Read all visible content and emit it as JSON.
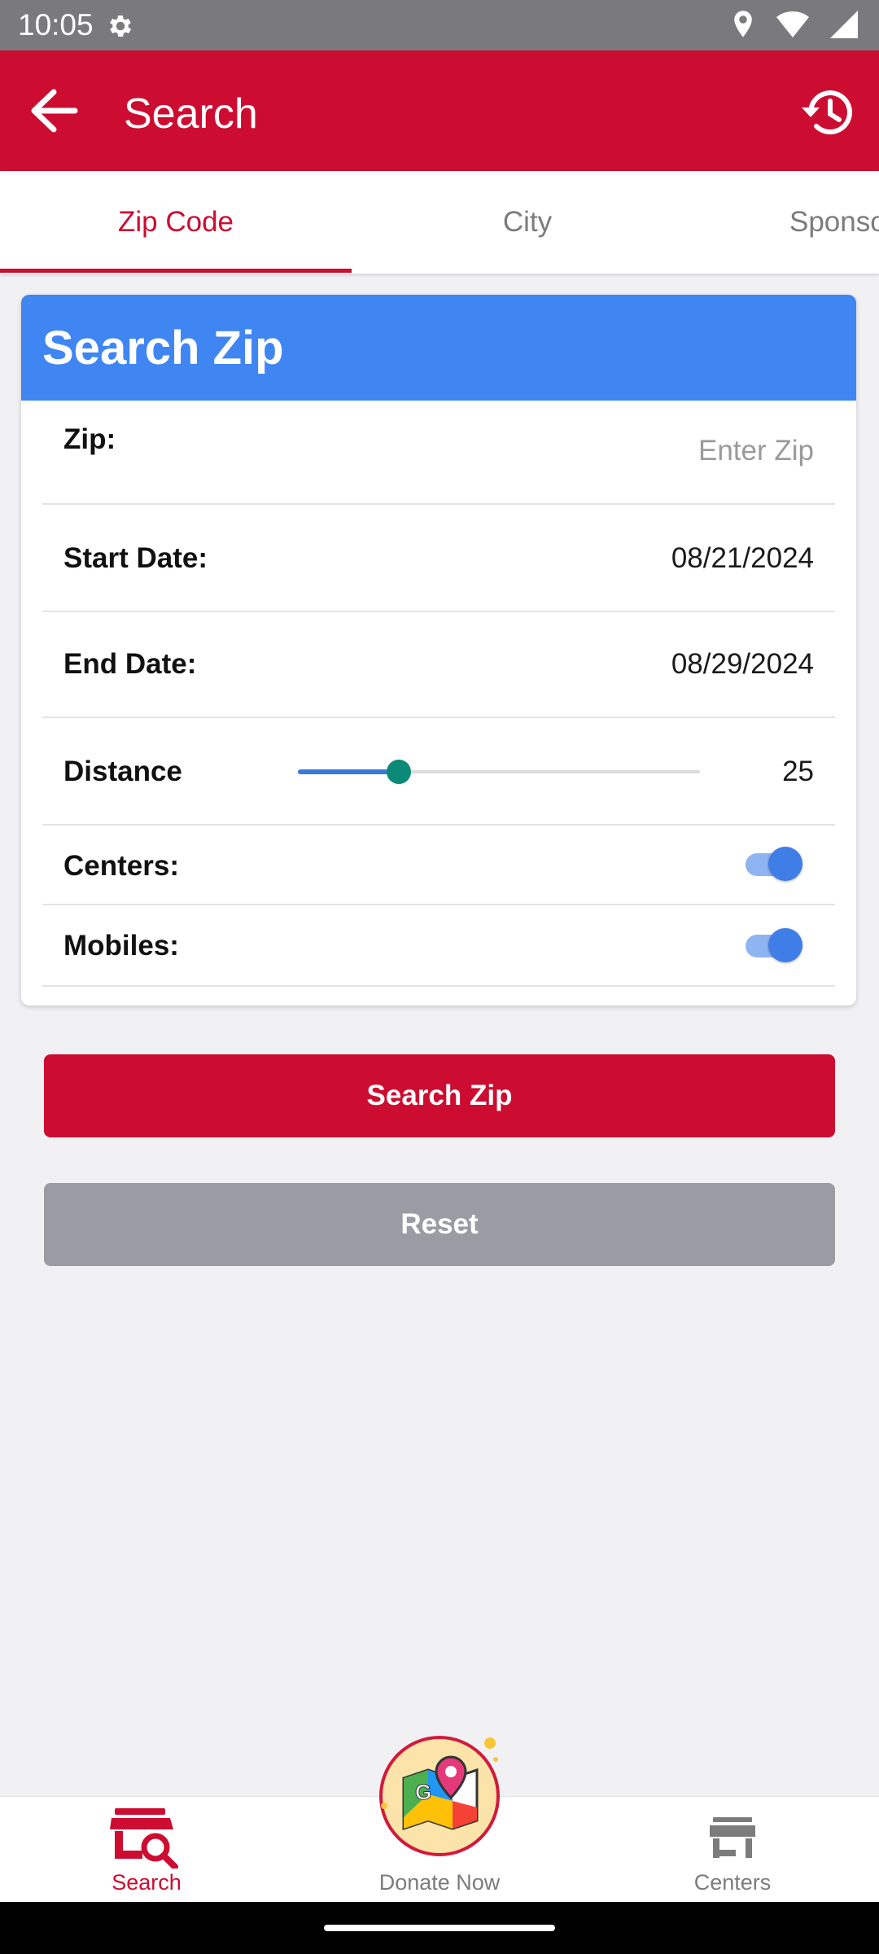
{
  "status_bar": {
    "time": "10:05"
  },
  "app_bar": {
    "title": "Search"
  },
  "tabs": [
    {
      "label": "Zip Code",
      "active": true
    },
    {
      "label": "City",
      "active": false
    },
    {
      "label": "Sponso",
      "active": false
    }
  ],
  "card": {
    "title": "Search Zip",
    "zip": {
      "label": "Zip:",
      "placeholder": "Enter Zip",
      "value": ""
    },
    "start_date": {
      "label": "Start Date:",
      "value": "08/21/2024"
    },
    "end_date": {
      "label": "End Date:",
      "value": "08/29/2024"
    },
    "distance": {
      "label": "Distance",
      "value": "25",
      "slider_fraction": 0.25
    },
    "centers": {
      "label": "Centers:",
      "on": true
    },
    "mobiles": {
      "label": "Mobiles:",
      "on": true
    }
  },
  "buttons": {
    "search": "Search Zip",
    "reset": "Reset"
  },
  "bottom_nav": [
    {
      "label": "Search",
      "active": true
    },
    {
      "label": "Donate Now",
      "active": false
    },
    {
      "label": "Centers",
      "active": false
    }
  ],
  "colors": {
    "brand_red": "#cc0c31",
    "card_header_blue": "#3f86f3",
    "slider_thumb": "#0c8a78",
    "reset_gray": "#9b9ba3"
  }
}
